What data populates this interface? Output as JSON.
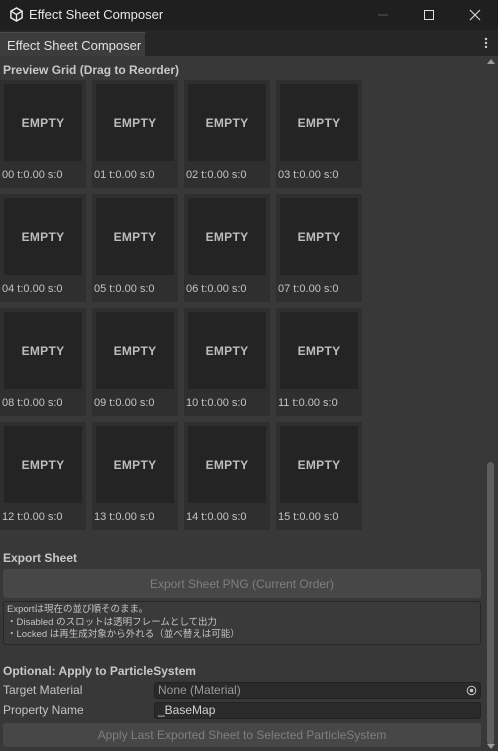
{
  "window": {
    "title": "Effect Sheet Composer"
  },
  "tab": {
    "label": "Effect Sheet Composer"
  },
  "preview": {
    "header": "Preview Grid (Drag to Reorder)",
    "cells": [
      {
        "thumb": "EMPTY",
        "label": "00  t:0.00 s:0"
      },
      {
        "thumb": "EMPTY",
        "label": "01  t:0.00 s:0"
      },
      {
        "thumb": "EMPTY",
        "label": "02  t:0.00 s:0"
      },
      {
        "thumb": "EMPTY",
        "label": "03  t:0.00 s:0"
      },
      {
        "thumb": "EMPTY",
        "label": "04  t:0.00 s:0"
      },
      {
        "thumb": "EMPTY",
        "label": "05  t:0.00 s:0"
      },
      {
        "thumb": "EMPTY",
        "label": "06  t:0.00 s:0"
      },
      {
        "thumb": "EMPTY",
        "label": "07  t:0.00 s:0"
      },
      {
        "thumb": "EMPTY",
        "label": "08  t:0.00 s:0"
      },
      {
        "thumb": "EMPTY",
        "label": "09  t:0.00 s:0"
      },
      {
        "thumb": "EMPTY",
        "label": "10  t:0.00 s:0"
      },
      {
        "thumb": "EMPTY",
        "label": "11  t:0.00 s:0"
      },
      {
        "thumb": "EMPTY",
        "label": "12  t:0.00 s:0"
      },
      {
        "thumb": "EMPTY",
        "label": "13  t:0.00 s:0"
      },
      {
        "thumb": "EMPTY",
        "label": "14  t:0.00 s:0"
      },
      {
        "thumb": "EMPTY",
        "label": "15  t:0.00 s:0"
      }
    ]
  },
  "export": {
    "header": "Export Sheet",
    "button": "Export Sheet PNG (Current Order)",
    "help": [
      "Exportは現在の並び順そのまま。",
      "・Disabled のスロットは透明フレームとして出力",
      "・Locked は再生成対象から外れる（並べ替えは可能）"
    ]
  },
  "apply": {
    "header": "Optional: Apply to ParticleSystem",
    "target_material_label": "Target Material",
    "target_material_value": "None (Material)",
    "property_name_label": "Property Name",
    "property_name_value": "_BaseMap",
    "button": "Apply Last Exported Sheet to Selected ParticleSystem"
  },
  "colors": {
    "background": "#383838",
    "titlebar": "#1f1f1f",
    "thumb": "#242424",
    "scroll_thumb": "#5e5e5e"
  },
  "icons": [
    "unity-logo-icon",
    "minimize-icon",
    "maximize-icon",
    "close-icon",
    "kebab-menu-icon",
    "object-picker-icon"
  ]
}
